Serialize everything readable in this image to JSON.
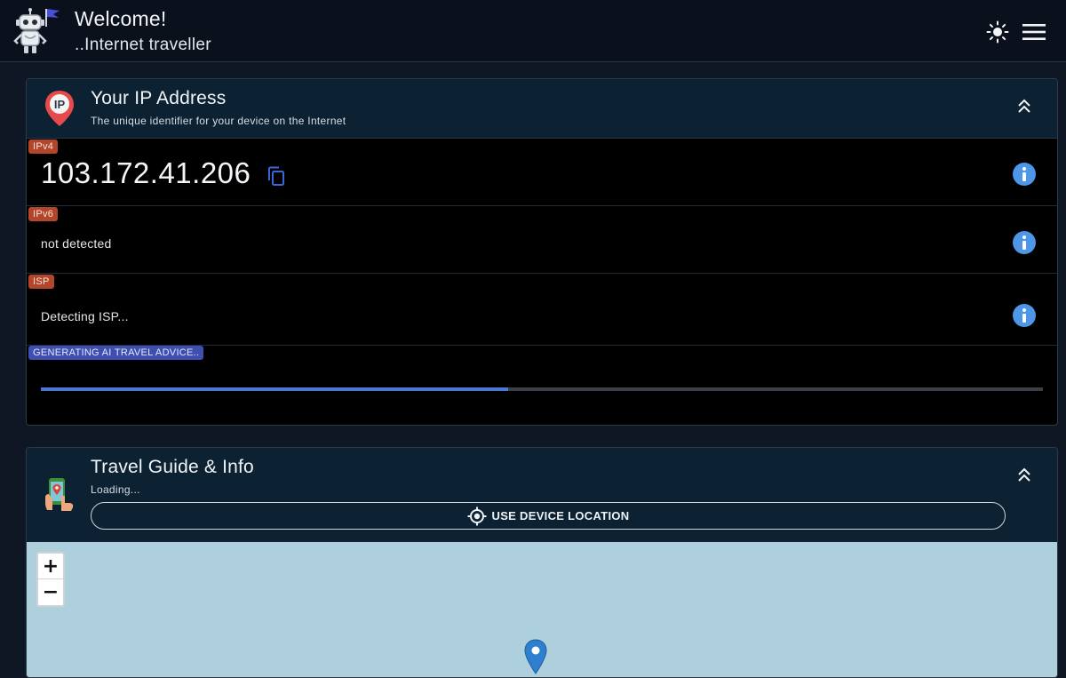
{
  "header": {
    "title": "Welcome!",
    "subtitle": "..Internet traveller",
    "icons": {
      "logo": "robot-flag-logo",
      "theme": "sun-icon",
      "menu": "hamburger-menu-icon"
    }
  },
  "ip_card": {
    "title": "Your IP Address",
    "subtitle": "The unique identifier for your device on the Internet",
    "rows": [
      {
        "tag": "IPv4",
        "value": "103.172.41.206"
      },
      {
        "tag": "IPv6",
        "value": "not detected"
      },
      {
        "tag": "ISP",
        "value": "Detecting ISP..."
      }
    ],
    "ai_status": {
      "tag": "GENERATING AI TRAVEL ADVICE..",
      "progress": 0.466
    }
  },
  "guide_card": {
    "title": "Travel Guide & Info",
    "status": "Loading...",
    "location_button": "USE DEVICE LOCATION",
    "map": {
      "zoom_in": "+",
      "zoom_out": "−"
    }
  },
  "colors": {
    "accent_blue": "#4b78d6",
    "tag_orange": "#b3452a",
    "tag_blue": "#3f4fb0",
    "info_blue": "#4d96e8",
    "map_water": "#aed0dc"
  }
}
